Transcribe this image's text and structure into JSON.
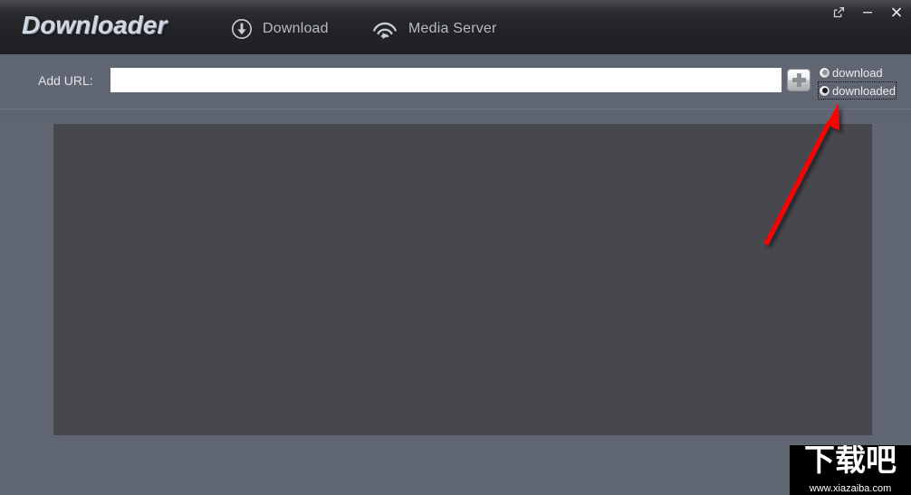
{
  "window": {
    "app_title": "Downloader",
    "controls": [
      {
        "name": "restore-window-button",
        "icon": "external-link-icon",
        "label": ""
      },
      {
        "name": "minimize-window-button",
        "icon": "minimize-icon",
        "label": ""
      },
      {
        "name": "close-window-button",
        "icon": "close-icon",
        "label": ""
      }
    ]
  },
  "nav": {
    "items": [
      {
        "label": "Download",
        "icon": "download-circle-icon"
      },
      {
        "label": "Media Server",
        "icon": "media-stream-icon"
      }
    ]
  },
  "toolbar": {
    "add_url_label": "Add URL:",
    "url_input_value": "",
    "url_input_placeholder": "",
    "add_button_icon": "plus-icon",
    "add_button_label": ""
  },
  "filter": {
    "options": [
      {
        "label": "download",
        "selected": false,
        "focused": false
      },
      {
        "label": "downloaded",
        "selected": true,
        "focused": true
      }
    ]
  },
  "main": {
    "list_empty_text": ""
  },
  "annotation": {
    "arrow_color": "#ff0000",
    "points_to": "downloaded"
  },
  "watermark": {
    "brand": "下载吧",
    "url": "www.xiazaiba.com"
  },
  "colors": {
    "body_background": "#616673",
    "titlebar_dark": "#222326",
    "panel_background": "#47484d",
    "accent_red": "#ff0000",
    "input_background": "#ffffff",
    "text_light": "#e2e5ea",
    "nav_text": "#b7bbc1"
  }
}
